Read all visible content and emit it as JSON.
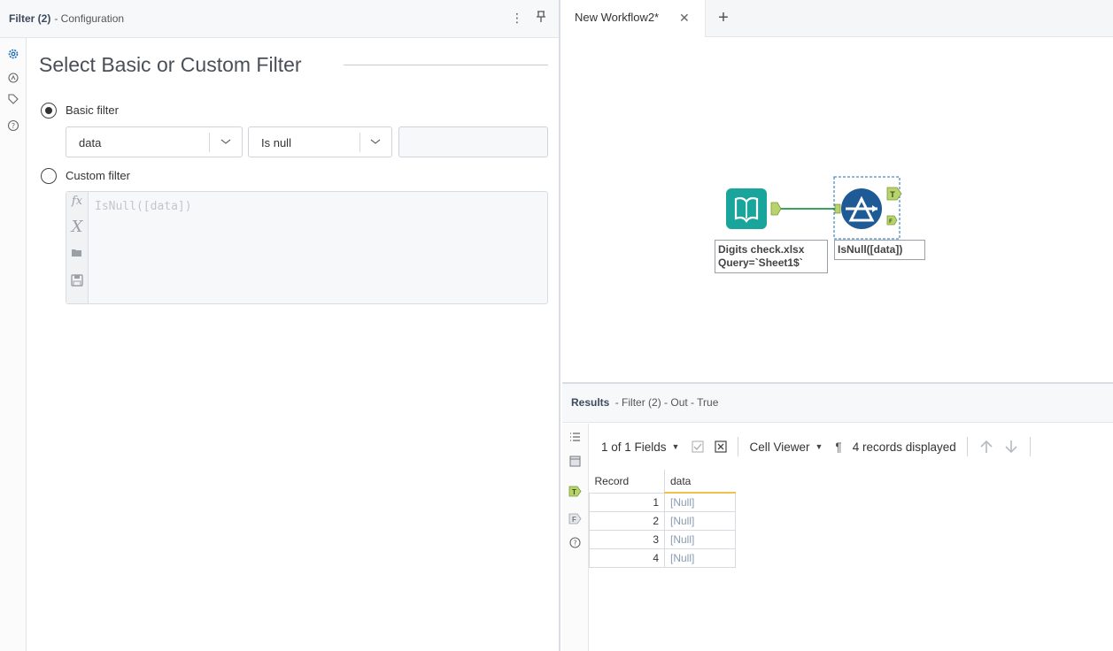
{
  "config": {
    "tool_name": "Filter (2)",
    "panel_label": "- Configuration",
    "section_title": "Select Basic or Custom Filter",
    "basic_filter_label": "Basic filter",
    "field_select_value": "data",
    "operator_select_value": "Is null",
    "value_input": "",
    "custom_filter_label": "Custom filter",
    "expression": "IsNull([data])",
    "selected_mode": "basic"
  },
  "workflow": {
    "tab_label": "New Workflow2*",
    "input_annotation_line1": "Digits check.xlsx",
    "input_annotation_line2": "Query=`Sheet1$`",
    "filter_annotation": "IsNull([data])",
    "true_anchor": "T",
    "false_anchor": "F"
  },
  "results": {
    "title": "Results",
    "subtitle": "- Filter (2) - Out - True",
    "fields_label": "1 of 1 Fields",
    "cell_viewer_label": "Cell Viewer",
    "records_displayed": "4 records displayed",
    "columns": [
      "Record",
      "data"
    ],
    "rows": [
      {
        "record": "1",
        "value": "[Null]"
      },
      {
        "record": "2",
        "value": "[Null]"
      },
      {
        "record": "3",
        "value": "[Null]"
      },
      {
        "record": "4",
        "value": "[Null]"
      }
    ]
  },
  "colors": {
    "accent": "#1e5a96",
    "input_tool": "#1aa59c",
    "anchor": "#b8d36b",
    "connection": "#3aa35a",
    "field_underline": "#f0c24a"
  }
}
